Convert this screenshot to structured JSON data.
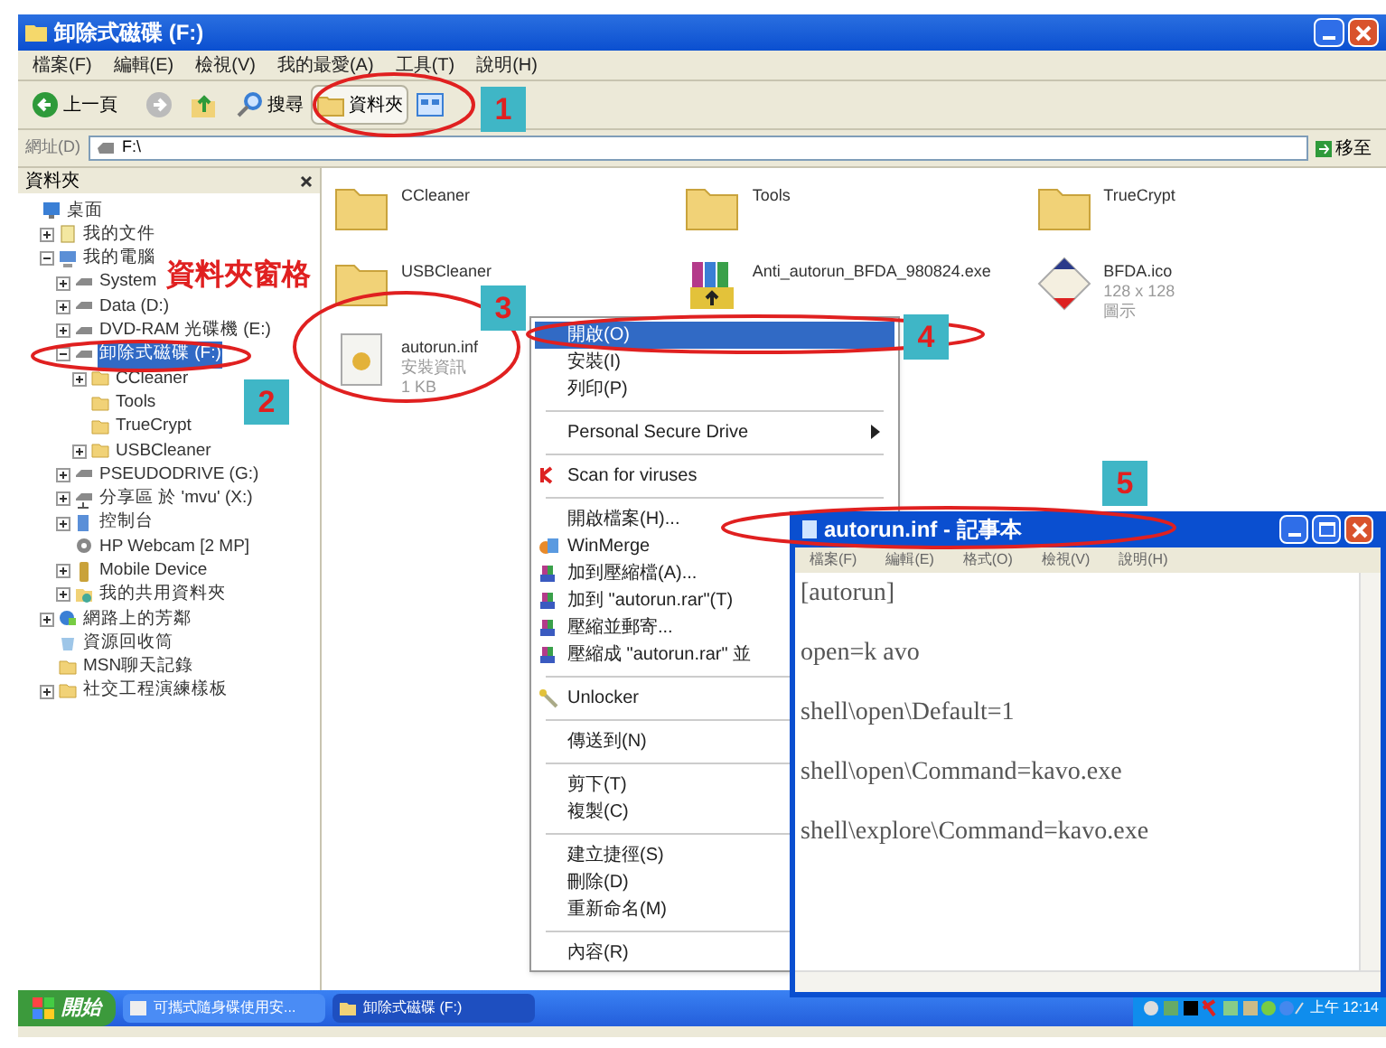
{
  "window": {
    "title": "卸除式磁碟 (F:)"
  },
  "menu_bar": [
    "檔案(F)",
    "編輯(E)",
    "檢視(V)",
    "我的最愛(A)",
    "工具(T)",
    "說明(H)"
  ],
  "toolbar": [
    {
      "kind": "back",
      "label": "上一頁",
      "pressed": false
    },
    {
      "kind": "forward",
      "pressed": false
    },
    {
      "kind": "up",
      "pressed": false
    },
    {
      "kind": "search",
      "label": "搜尋",
      "pressed": false
    },
    {
      "kind": "folders",
      "label": "資料夾",
      "pressed": true
    },
    {
      "kind": "views",
      "pressed": false
    }
  ],
  "address": {
    "label": "網址(D)",
    "value": "F:\\",
    "go": "移至"
  },
  "folder_pane": {
    "title": "資料夾",
    "tree": [
      {
        "kind": "desktop",
        "label": "桌面",
        "selected": false,
        "children": [
          {
            "kind": "documents",
            "label": "我的文件",
            "expanded": false,
            "selected": false
          },
          {
            "kind": "computer",
            "label": "我的電腦",
            "expanded": true,
            "selected": false,
            "children": [
              {
                "kind": "drive",
                "label": "System",
                "expanded": false,
                "selected": false
              },
              {
                "kind": "drive",
                "label": "Data (D:)",
                "expanded": false,
                "selected": false
              },
              {
                "kind": "drive",
                "label": "DVD-RAM 光碟機 (E:)",
                "expanded": false,
                "selected": false
              },
              {
                "kind": "drive",
                "label": "卸除式磁碟 (F:)",
                "expanded": true,
                "selected": true,
                "children": [
                  {
                    "kind": "folder",
                    "label": "CCleaner",
                    "expanded": false,
                    "selected": false
                  },
                  {
                    "kind": "folder",
                    "label": "Tools",
                    "selected": false
                  },
                  {
                    "kind": "folder",
                    "label": "TrueCrypt",
                    "selected": false
                  },
                  {
                    "kind": "folder",
                    "label": "USBCleaner",
                    "expanded": false,
                    "selected": false
                  }
                ]
              },
              {
                "kind": "drive",
                "label": "PSEUDODRIVE (G:)",
                "expanded": false,
                "selected": false
              },
              {
                "kind": "share",
                "label": "分享區 於 'mvu' (X:)",
                "expanded": false,
                "selected": false
              },
              {
                "kind": "control",
                "label": "控制台",
                "expanded": false,
                "selected": false
              },
              {
                "kind": "webcam",
                "label": "HP Webcam [2 MP]",
                "selected": false
              },
              {
                "kind": "phone",
                "label": "Mobile Device",
                "expanded": false,
                "selected": false
              },
              {
                "kind": "shared",
                "label": "我的共用資料夾",
                "expanded": false,
                "selected": false
              }
            ]
          },
          {
            "kind": "network",
            "label": "網路上的芳鄰",
            "expanded": false,
            "selected": false
          },
          {
            "kind": "recycle",
            "label": "資源回收筒",
            "selected": false
          },
          {
            "kind": "folder",
            "label": "MSN聊天記錄",
            "selected": false
          },
          {
            "kind": "folder",
            "label": "社交工程演練樣板",
            "expanded": false,
            "selected": false
          }
        ]
      }
    ]
  },
  "annotation_label": "資料夾窗格",
  "files": [
    {
      "kind": "folder",
      "name": "CCleaner"
    },
    {
      "kind": "folder",
      "name": "Tools"
    },
    {
      "kind": "folder",
      "name": "TrueCrypt"
    },
    {
      "kind": "folder",
      "name": "USBCleaner"
    },
    {
      "kind": "archive",
      "name": "Anti_autorun_BFDA_980824.exe"
    },
    {
      "kind": "image",
      "name": "BFDA.ico",
      "details": [
        "128 x 128",
        "圖示"
      ]
    },
    {
      "kind": "settings",
      "name": "autorun.inf",
      "details": [
        "安裝資訊",
        "1 KB"
      ]
    }
  ],
  "context_menu": [
    {
      "kind": "plain",
      "label": "開啟(O)",
      "selected": true
    },
    {
      "kind": "plain",
      "label": "安裝(I)",
      "selected": false
    },
    {
      "kind": "plain",
      "label": "列印(P)",
      "selected": false
    },
    {
      "kind": "separator"
    },
    {
      "kind": "submenu",
      "label": "Personal Secure Drive",
      "selected": false
    },
    {
      "kind": "separator"
    },
    {
      "kind": "scan",
      "label": "Scan for viruses",
      "selected": false
    },
    {
      "kind": "separator"
    },
    {
      "kind": "plain",
      "label": "開啟檔案(H)...",
      "selected": false
    },
    {
      "kind": "compare",
      "label": "WinMerge",
      "selected": false
    },
    {
      "kind": "archive",
      "label": "加到壓縮檔(A)...",
      "selected": false
    },
    {
      "kind": "archive",
      "label": "加到 \"autorun.rar\"(T)",
      "selected": false
    },
    {
      "kind": "archive",
      "label": "壓縮並郵寄...",
      "selected": false
    },
    {
      "kind": "archive",
      "label": "壓縮成 \"autorun.rar\" 並",
      "selected": false
    },
    {
      "kind": "separator"
    },
    {
      "kind": "unlock",
      "label": "Unlocker",
      "selected": false
    },
    {
      "kind": "separator"
    },
    {
      "kind": "plain",
      "label": "傳送到(N)",
      "selected": false
    },
    {
      "kind": "separator"
    },
    {
      "kind": "plain",
      "label": "剪下(T)",
      "selected": false
    },
    {
      "kind": "plain",
      "label": "複製(C)",
      "selected": false
    },
    {
      "kind": "separator"
    },
    {
      "kind": "plain",
      "label": "建立捷徑(S)",
      "selected": false
    },
    {
      "kind": "plain",
      "label": "刪除(D)",
      "selected": false
    },
    {
      "kind": "plain",
      "label": "重新命名(M)",
      "selected": false
    },
    {
      "kind": "separator"
    },
    {
      "kind": "plain",
      "label": "內容(R)",
      "selected": false
    }
  ],
  "notepad": {
    "title": "autorun.inf - 記事本",
    "menu": [
      "檔案(F)",
      "編輯(E)",
      "格式(O)",
      "檢視(V)",
      "說明(H)"
    ],
    "lines": [
      "[autorun]",
      "open=k avo",
      "shell\\open\\Default=1",
      "shell\\open\\Command=kavo.exe",
      "shell\\explore\\Command=kavo.exe"
    ]
  },
  "taskbar": {
    "start": "開始",
    "tasks": [
      {
        "label": "可攜式隨身碟使用安...",
        "selected": false
      },
      {
        "label": "卸除式磁碟 (F:)",
        "selected": true
      }
    ],
    "clock": "上午 12:14"
  },
  "badges": [
    "1",
    "2",
    "3",
    "4",
    "5"
  ]
}
